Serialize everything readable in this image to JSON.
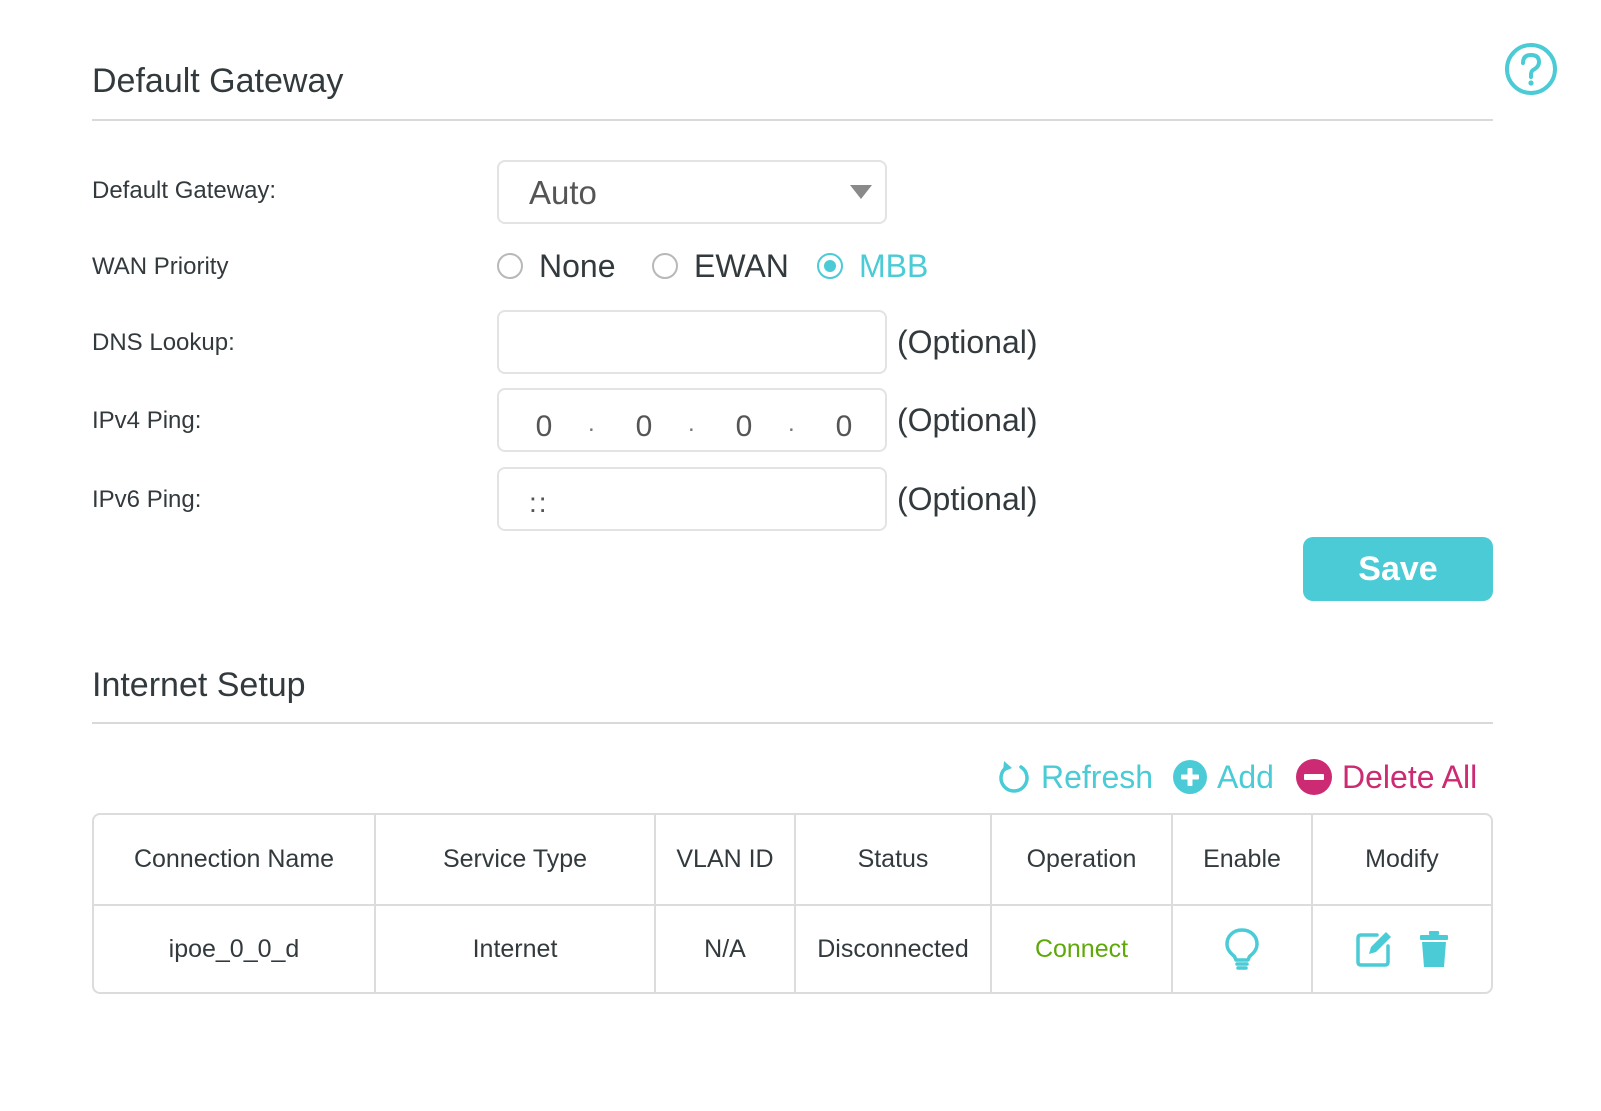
{
  "gateway_section": {
    "title": "Default Gateway"
  },
  "default_gateway": {
    "label": "Default Gateway:",
    "value": "Auto"
  },
  "wan_priority": {
    "label": "WAN Priority",
    "options": [
      "None",
      "EWAN",
      "MBB"
    ],
    "selected": "MBB"
  },
  "dns_lookup": {
    "label": "DNS Lookup:",
    "value": "",
    "hint": "(Optional)"
  },
  "ipv4_ping": {
    "label": "IPv4 Ping:",
    "octets": [
      "0",
      "0",
      "0",
      "0"
    ],
    "hint": "(Optional)"
  },
  "ipv6_ping": {
    "label": "IPv6 Ping:",
    "value": "::",
    "hint": "(Optional)"
  },
  "save_label": "Save",
  "internet_section": {
    "title": "Internet Setup"
  },
  "toolbar": {
    "refresh_label": "Refresh",
    "add_label": "Add",
    "delete_all_label": "Delete All"
  },
  "table": {
    "headers": [
      "Connection Name",
      "Service Type",
      "VLAN ID",
      "Status",
      "Operation",
      "Enable",
      "Modify"
    ],
    "rows": [
      {
        "connection_name": "ipoe_0_0_d",
        "service_type": "Internet",
        "vlan_id": "N/A",
        "status": "Disconnected",
        "operation": "Connect"
      }
    ]
  },
  "colors": {
    "accent": "#4acbd6",
    "danger": "#cc2a72",
    "connect": "#5fa80a"
  },
  "icons": [
    "help-icon",
    "chevron-down-icon",
    "refresh-icon",
    "add-icon",
    "delete-all-icon",
    "bulb-icon",
    "edit-icon",
    "trash-icon"
  ]
}
